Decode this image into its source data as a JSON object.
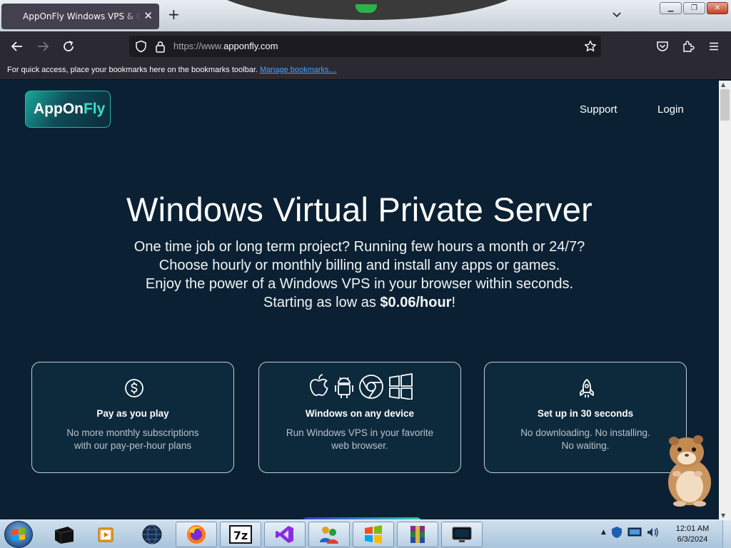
{
  "browser": {
    "tab_title": "AppOnFly Windows VPS & Clo",
    "tab_close": "✕",
    "new_tab": "+",
    "url_prefix": "https://www.",
    "url_domain": "apponfly.com",
    "bookmarks_hint": "For quick access, place your bookmarks here on the bookmarks toolbar.",
    "manage_bookmarks": "Manage bookmarks…",
    "icons": [
      "back-arrow-icon",
      "forward-arrow-icon",
      "reload-icon",
      "shield-icon",
      "lock-icon",
      "star-icon",
      "pocket-icon",
      "extensions-icon",
      "menu-icon"
    ]
  },
  "page": {
    "logo_a": "AppOn",
    "logo_b": "Fly",
    "nav": {
      "support": "Support",
      "login": "Login"
    },
    "hero": {
      "title": "Windows Virtual Private Server",
      "line1": "One time job or long term project? Running few hours a month or 24/7?",
      "line2": "Choose hourly or monthly billing and install any apps or games.",
      "line3": "Enjoy the power of a Windows VPS in your browser within seconds.",
      "line4_prefix": "Starting as low as ",
      "line4_price": "$0.06/hour",
      "line4_suffix": "!"
    },
    "cards": [
      {
        "title": "Pay as you play",
        "desc1": "No more monthly subscriptions",
        "desc2": "with our pay-per-hour plans",
        "icon": "dollar-icon"
      },
      {
        "title": "Windows on any device",
        "desc1": "Run Windows VPS in your favorite",
        "desc2": "web browser.",
        "icon": "platforms-icon"
      },
      {
        "title": "Set up in 30 seconds",
        "desc1": "No downloading. No installing.",
        "desc2": "No waiting.",
        "icon": "rocket-icon"
      }
    ],
    "accent": "#39e0c8",
    "background": "#0b2133"
  },
  "taskbar": {
    "clock_time": "12:01 AM",
    "clock_date": "6/3/2024"
  }
}
